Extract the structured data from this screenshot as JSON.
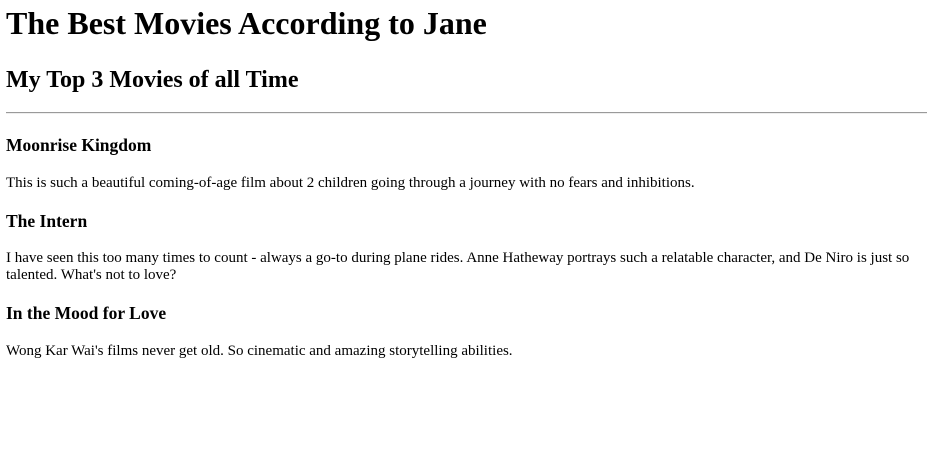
{
  "page": {
    "title": "The Best Movies According to Jane",
    "subtitle": "My Top 3 Movies of all Time"
  },
  "movies": [
    {
      "title": "Moonrise Kingdom",
      "description": "This is such a beautiful coming-of-age film about 2 children going through a journey with no fears and inhibitions."
    },
    {
      "title": "The Intern",
      "description": "I have seen this too many times to count - always a go-to during plane rides. Anne Hatheway portrays such a relatable character, and De Niro is just so talented. What's not to love?"
    },
    {
      "title": "In the Mood for Love",
      "description": "Wong Kar Wai's films never get old. So cinematic and amazing storytelling abilities."
    }
  ]
}
